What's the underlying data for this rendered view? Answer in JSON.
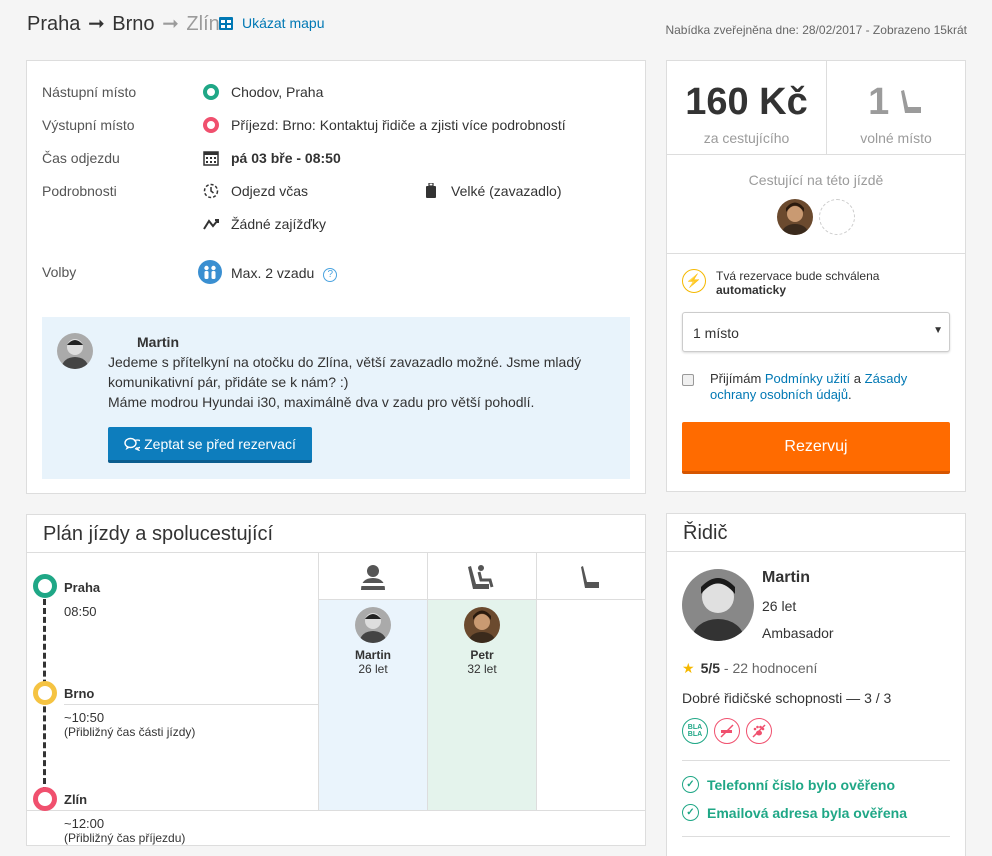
{
  "header": {
    "from": "Praha",
    "via": "Brno",
    "to": "Zlín",
    "map_link": "Ukázat mapu",
    "published": "Nabídka zveřejněna dne: 28/02/2017 - Zobrazeno 15krát"
  },
  "details": {
    "pickup_label": "Nástupní místo",
    "pickup_value": "Chodov, Praha",
    "dropoff_label": "Výstupní místo",
    "dropoff_value": "Příjezd: Brno: Kontaktuj řidiče a zjisti více podrobností",
    "time_label": "Čas odjezdu",
    "time_value": "pá 03 bře - 08:50",
    "info_label": "Podrobnosti",
    "punctual": "Odjezd včas",
    "luggage": "Velké (zavazadlo)",
    "detours": "Žádné zajížďky",
    "options_label": "Volby",
    "options_value": "Max. 2 vzadu"
  },
  "message": {
    "author": "Martin",
    "line1": "Jedeme s přítelkyní na otočku do Zlína, větší zavazadlo možné. Jsme mladý komunikativní pár, přidáte se k nám? :)",
    "line2": "Máme modrou Hyundai i30, maximálně dva v zadu pro větší pohodlí.",
    "ask_button": "Zeptat se před rezervací"
  },
  "booking": {
    "price": "160 Kč",
    "price_label": "za cestujícího",
    "seats": "1",
    "seats_label": "volné místo",
    "passengers_title": "Cestující na této jízdě",
    "auto_line1": "Tvá rezervace bude schválena",
    "auto_line2": "automaticky",
    "seat_select": "1 místo",
    "terms_pre": "Přijímám ",
    "terms_link1": "Podmínky užití",
    "terms_mid": " a ",
    "terms_link2": "Zásady ochrany osobních údajů",
    "terms_post": ".",
    "book_button": "Rezervuj"
  },
  "plan": {
    "title": "Plán jízdy a spolucestující",
    "stops": [
      {
        "name": "Praha",
        "time": "08:50",
        "sub": ""
      },
      {
        "name": "Brno",
        "time": "~10:50",
        "sub": "(Přibližný čas části jízdy)"
      },
      {
        "name": "Zlín",
        "time": "~12:00",
        "sub": "(Přibližný čas příjezdu)"
      }
    ],
    "people": [
      {
        "name": "Martin",
        "age": "26 let"
      },
      {
        "name": "Petr",
        "age": "32 let"
      }
    ],
    "colors": {
      "driver_col": "#eaf4fc",
      "passenger_col": "#e4f3ec",
      "stop_start": "#1fa786",
      "stop_mid": "#f5c342",
      "stop_end": "#f0506e"
    }
  },
  "driver": {
    "title": "Řidič",
    "name": "Martin",
    "age": "26 let",
    "level": "Ambasador",
    "rating": "5/5",
    "rating_count": " - 22 hodnocení",
    "skills": "Dobré řidičské schopnosti — 3 / 3",
    "pref_bla": "BLA BLA",
    "phone_verified": "Telefonní číslo bylo ověřeno",
    "email_verified": "Emailová adresa byla ověřena"
  }
}
